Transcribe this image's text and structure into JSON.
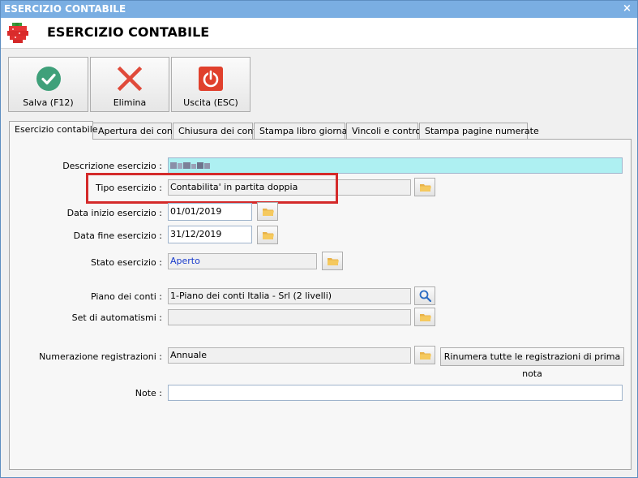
{
  "window": {
    "title": "ESERCIZIO CONTABILE",
    "close_glyph": "×"
  },
  "header": {
    "title": "ESERCIZIO CONTABILE",
    "logo_icon": "strawberry-logo"
  },
  "toolbar": {
    "save_label": "Salva (F12)",
    "delete_label": "Elimina",
    "exit_label": "Uscita (ESC)",
    "colors": {
      "save": "#3fa07a",
      "delete": "#e04a3a",
      "exit": "#e0402c"
    }
  },
  "tabs": [
    {
      "label": "Esercizio contabile",
      "active": true
    },
    {
      "label": "Apertura dei conti"
    },
    {
      "label": "Chiusura dei conti"
    },
    {
      "label": "Stampa libro giornale"
    },
    {
      "label": "Vincoli e controlli"
    },
    {
      "label": "Stampa pagine numerate"
    }
  ],
  "form": {
    "descrizione": {
      "label": "Descrizione esercizio :",
      "value": ""
    },
    "tipo": {
      "label": "Tipo esercizio :",
      "value": "Contabilita' in partita doppia"
    },
    "data_inizio": {
      "label": "Data inizio esercizio :",
      "value": "01/01/2019"
    },
    "data_fine": {
      "label": "Data fine esercizio :",
      "value": "31/12/2019"
    },
    "stato": {
      "label": "Stato esercizio :",
      "value": "Aperto",
      "value_color": "#1a3ccc"
    },
    "piano": {
      "label": "Piano dei conti :",
      "value": "1-Piano dei conti Italia - Srl (2 livelli)"
    },
    "automatismi": {
      "label": "Set di automatismi :",
      "value": ""
    },
    "numerazione": {
      "label": "Numerazione registrazioni :",
      "value": "Annuale"
    },
    "note": {
      "label": "Note :",
      "value": ""
    },
    "renumber_button": "Rinumera tutte le registrazioni di prima nota"
  }
}
